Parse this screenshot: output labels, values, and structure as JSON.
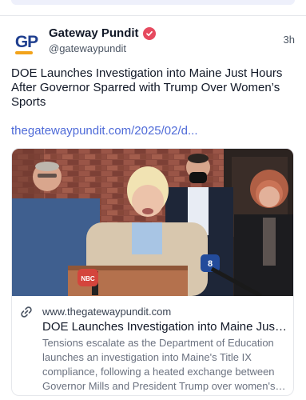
{
  "colors": {
    "accent": "#4f6bd8",
    "verified": "#e64a5f",
    "brand_blue": "#1f3f8f",
    "brand_orange": "#f2a31b"
  },
  "post": {
    "avatar_text": "GP",
    "display_name": "Gateway Pundit",
    "verified_icon": "verified-badge-icon",
    "handle": "@gatewaypundit",
    "time": "3h",
    "text": "DOE Launches Investigation into Maine Just Hours After Governor Sparred with Trump Over Women’s Sports",
    "link_text": "thegatewaypundit.com/2025/02/d...",
    "card": {
      "link_icon": "link-icon",
      "domain": "www.thegatewaypundit.com",
      "title": "DOE Launches Investigation into Maine Just H...",
      "description": "Tensions escalate as the Department of Education launches an investigation into Maine's Title IX compliance, following a heated exchange between Governor Mills and President Trump over women's sp...",
      "microphone_labels": [
        "NBC",
        "8"
      ]
    }
  }
}
